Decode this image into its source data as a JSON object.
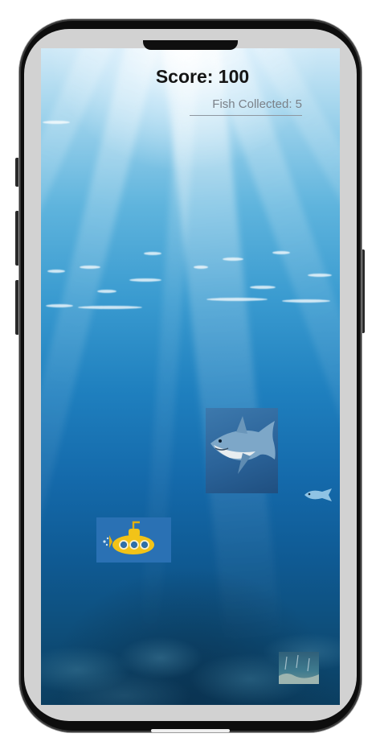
{
  "hud": {
    "score_label": "Score: 100",
    "fish_collected_label": "Fish Collected: 5"
  },
  "game": {
    "score": 100,
    "fish_collected": 5
  },
  "sprites": {
    "player": "yellow-submarine-icon",
    "enemy": "shark-icon",
    "collectible": "small-fish-icon",
    "extra": "seabed-tile-icon"
  },
  "colors": {
    "water_top": "#cfe9f7",
    "water_deep": "#0b3e60",
    "submarine": "#f2c318",
    "hud_text": "#151515"
  }
}
